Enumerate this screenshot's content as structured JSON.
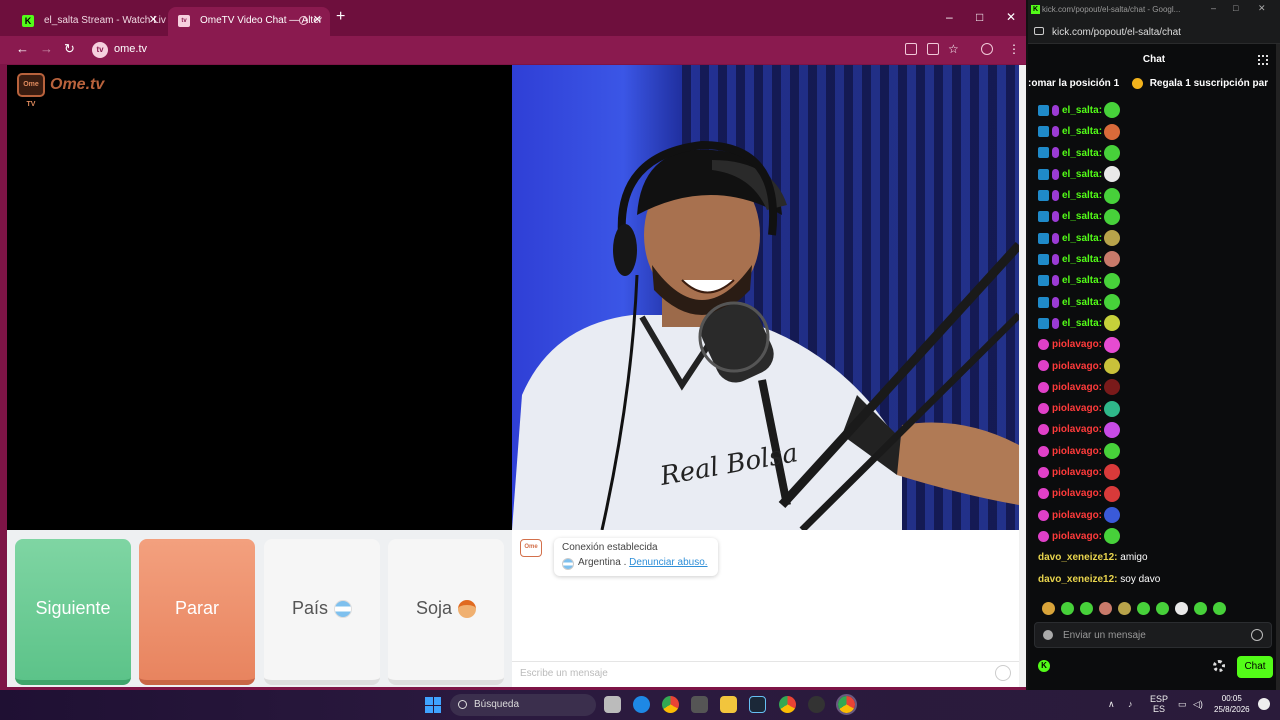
{
  "browser": {
    "tabs": [
      {
        "title": "el_salta Stream - Watch Live on",
        "favicon": "K",
        "active": false
      },
      {
        "title": "OmeTV Video Chat — Alter",
        "favicon": "tv",
        "active": true
      }
    ],
    "new_tab": "+",
    "url": "ome.tv",
    "window_controls": {
      "minimize": "–",
      "maximize": "□",
      "close": "✕"
    }
  },
  "ometv": {
    "logo_text": "Ome.tv",
    "logo_badge": "Ome TV",
    "buttons": {
      "next": "Siguiente",
      "stop": "Parar",
      "country": "País",
      "gender": "Soja"
    },
    "notice": {
      "status": "Conexión establecida",
      "country": "Argentina .",
      "report_link": "Denunciar abuso."
    },
    "chat_placeholder": "Escribe un mensaje"
  },
  "kick": {
    "window_title": "kick.com/popout/el-salta/chat - Googl...",
    "url": "kick.com/popout/el-salta/chat",
    "chat_header": "Chat",
    "pinned": {
      "part1": ":omar la posición 1",
      "part2": "Regala 1 suscripción par"
    },
    "messages": [
      {
        "user": "el_salta:",
        "type": "streamer",
        "emote_color": "#47d13a"
      },
      {
        "user": "el_salta:",
        "type": "streamer",
        "emote_color": "#d96a3a"
      },
      {
        "user": "el_salta:",
        "type": "streamer",
        "emote_color": "#47d13a"
      },
      {
        "user": "el_salta:",
        "type": "streamer",
        "emote_color": "#e9e9e9"
      },
      {
        "user": "el_salta:",
        "type": "streamer",
        "emote_color": "#47d13a"
      },
      {
        "user": "el_salta:",
        "type": "streamer",
        "emote_color": "#47d13a"
      },
      {
        "user": "el_salta:",
        "type": "streamer",
        "emote_color": "#b8a34a"
      },
      {
        "user": "el_salta:",
        "type": "streamer",
        "emote_color": "#c97a6a"
      },
      {
        "user": "el_salta:",
        "type": "streamer",
        "emote_color": "#47d13a"
      },
      {
        "user": "el_salta:",
        "type": "streamer",
        "emote_color": "#47d13a"
      },
      {
        "user": "el_salta:",
        "type": "streamer",
        "emote_color": "#c6d13a"
      },
      {
        "user": "piolavago:",
        "type": "viewer",
        "emote_color": "#e64bd1"
      },
      {
        "user": "piolavago:",
        "type": "viewer",
        "emote_color": "#c9c23a"
      },
      {
        "user": "piolavago:",
        "type": "viewer",
        "emote_color": "#7a1a1a"
      },
      {
        "user": "piolavago:",
        "type": "viewer",
        "emote_color": "#2fb88a"
      },
      {
        "user": "piolavago:",
        "type": "viewer",
        "emote_color": "#c84be6"
      },
      {
        "user": "piolavago:",
        "type": "viewer",
        "emote_color": "#47d13a"
      },
      {
        "user": "piolavago:",
        "type": "viewer",
        "emote_color": "#d93a3a"
      },
      {
        "user": "piolavago:",
        "type": "viewer",
        "emote_color": "#d93a3a"
      },
      {
        "user": "piolavago:",
        "type": "viewer",
        "emote_color": "#3a5ad9"
      },
      {
        "user": "piolavago:",
        "type": "viewer",
        "emote_color": "#47d13a"
      },
      {
        "user": "davo_xeneize12:",
        "type": "text",
        "text": "amigo"
      },
      {
        "user": "davo_xeneize12:",
        "type": "text",
        "text": "soy davo"
      }
    ],
    "emote_bar": [
      "#d9a43a",
      "#47d13a",
      "#47d13a",
      "#c97a6a",
      "#b8a34a",
      "#47d13a",
      "#47d13a",
      "#e9e9e9",
      "#47d13a",
      "#47d13a"
    ],
    "input_placeholder": "Enviar un mensaje",
    "send_label": "Chat",
    "accent": "#53fc18"
  },
  "taskbar": {
    "search_label": "Búsqueda",
    "lang": "ESP",
    "lang_sub": "ES",
    "time": "00:05",
    "date": "25/8/2026"
  }
}
